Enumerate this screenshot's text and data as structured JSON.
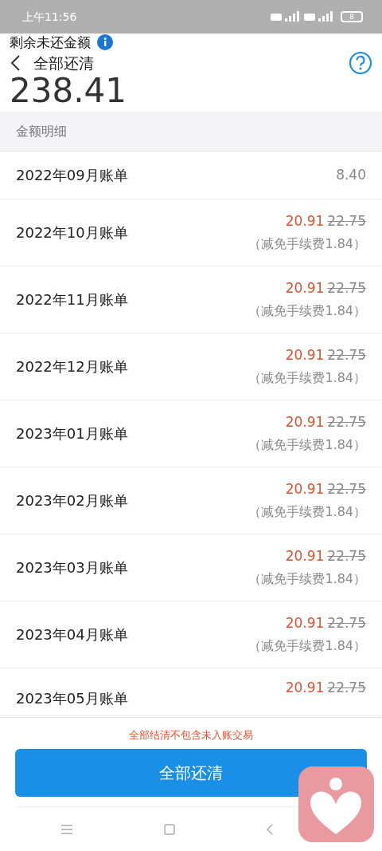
{
  "status_bar": {
    "time": "上午11:56",
    "battery": "8"
  },
  "header": {
    "balance_label": "剩余未还金额",
    "title": "全部还清",
    "balance": "238.41"
  },
  "section_title": "金额明细",
  "bills": [
    {
      "kind": "plain",
      "month": "2022年09月账单",
      "amount": "8.40"
    },
    {
      "kind": "discount",
      "month": "2022年10月账单",
      "amount": "20.91",
      "original": "22.75",
      "note": "（减免手续费1.84）"
    },
    {
      "kind": "discount",
      "month": "2022年11月账单",
      "amount": "20.91",
      "original": "22.75",
      "note": "（减免手续费1.84）"
    },
    {
      "kind": "discount",
      "month": "2022年12月账单",
      "amount": "20.91",
      "original": "22.75",
      "note": "（减免手续费1.84）"
    },
    {
      "kind": "discount",
      "month": "2023年01月账单",
      "amount": "20.91",
      "original": "22.75",
      "note": "（减免手续费1.84）"
    },
    {
      "kind": "discount",
      "month": "2023年02月账单",
      "amount": "20.91",
      "original": "22.75",
      "note": "（减免手续费1.84）"
    },
    {
      "kind": "discount",
      "month": "2023年03月账单",
      "amount": "20.91",
      "original": "22.75",
      "note": "（减免手续费1.84）"
    },
    {
      "kind": "discount",
      "month": "2023年04月账单",
      "amount": "20.91",
      "original": "22.75",
      "note": "（减免手续费1.84）"
    },
    {
      "kind": "discount",
      "month": "2023年05月账单",
      "amount": "20.91",
      "original": "22.75"
    }
  ],
  "footer": {
    "notice": "全部结清不包含未入账交易",
    "button": "全部还清"
  }
}
